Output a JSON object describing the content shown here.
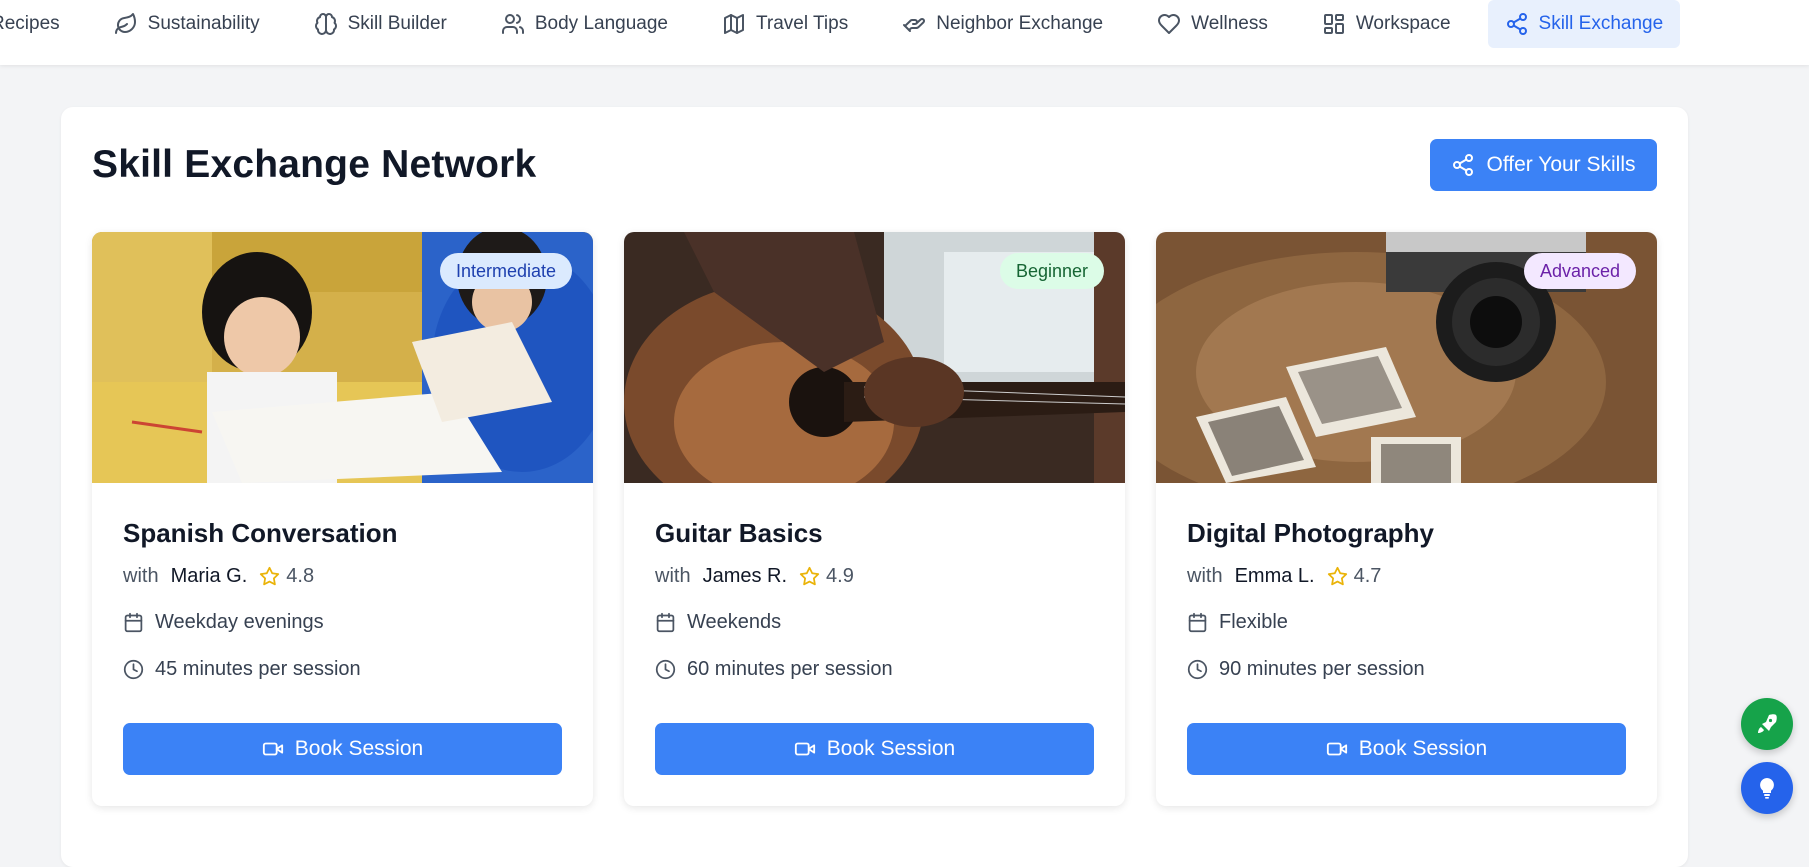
{
  "nav": {
    "items": [
      {
        "label": "Recipes",
        "icon": "recipes-icon"
      },
      {
        "label": "Sustainability",
        "icon": "leaf-icon"
      },
      {
        "label": "Skill Builder",
        "icon": "brain-icon"
      },
      {
        "label": "Body Language",
        "icon": "users-icon"
      },
      {
        "label": "Travel Tips",
        "icon": "map-icon"
      },
      {
        "label": "Neighbor Exchange",
        "icon": "handshake-icon"
      },
      {
        "label": "Wellness",
        "icon": "heart-icon"
      },
      {
        "label": "Workspace",
        "icon": "layout-grid-icon"
      },
      {
        "label": "Skill Exchange",
        "icon": "share-icon",
        "active": true
      }
    ]
  },
  "main": {
    "title": "Skill Exchange Network",
    "offer_button": "Offer Your Skills"
  },
  "cards": [
    {
      "title": "Spanish Conversation",
      "level": "Intermediate",
      "with": "with",
      "teacher": "Maria G.",
      "rating": "4.8",
      "schedule": "Weekday evenings",
      "duration": "45 minutes per session",
      "button": "Book Session",
      "image": "children-studying-photo"
    },
    {
      "title": "Guitar Basics",
      "level": "Beginner",
      "with": "with",
      "teacher": "James R.",
      "rating": "4.9",
      "schedule": "Weekends",
      "duration": "60 minutes per session",
      "button": "Book Session",
      "image": "acoustic-guitar-photo"
    },
    {
      "title": "Digital Photography",
      "level": "Advanced",
      "with": "with",
      "teacher": "Emma L.",
      "rating": "4.7",
      "schedule": "Flexible",
      "duration": "90 minutes per session",
      "button": "Book Session",
      "image": "camera-and-photos-photo"
    }
  ],
  "colors": {
    "accent": "#3b82f6",
    "star": "#eab308",
    "intermediate_bg": "#dbeafe",
    "intermediate_fg": "#1e40af",
    "beginner_bg": "#dcfce7",
    "beginner_fg": "#166534",
    "advanced_bg": "#f3e8ff",
    "advanced_fg": "#6b21a8",
    "fab_green": "#16a34a",
    "fab_blue": "#2563eb"
  },
  "fabs": [
    {
      "icon": "rocket-icon"
    },
    {
      "icon": "lightbulb-icon"
    }
  ]
}
